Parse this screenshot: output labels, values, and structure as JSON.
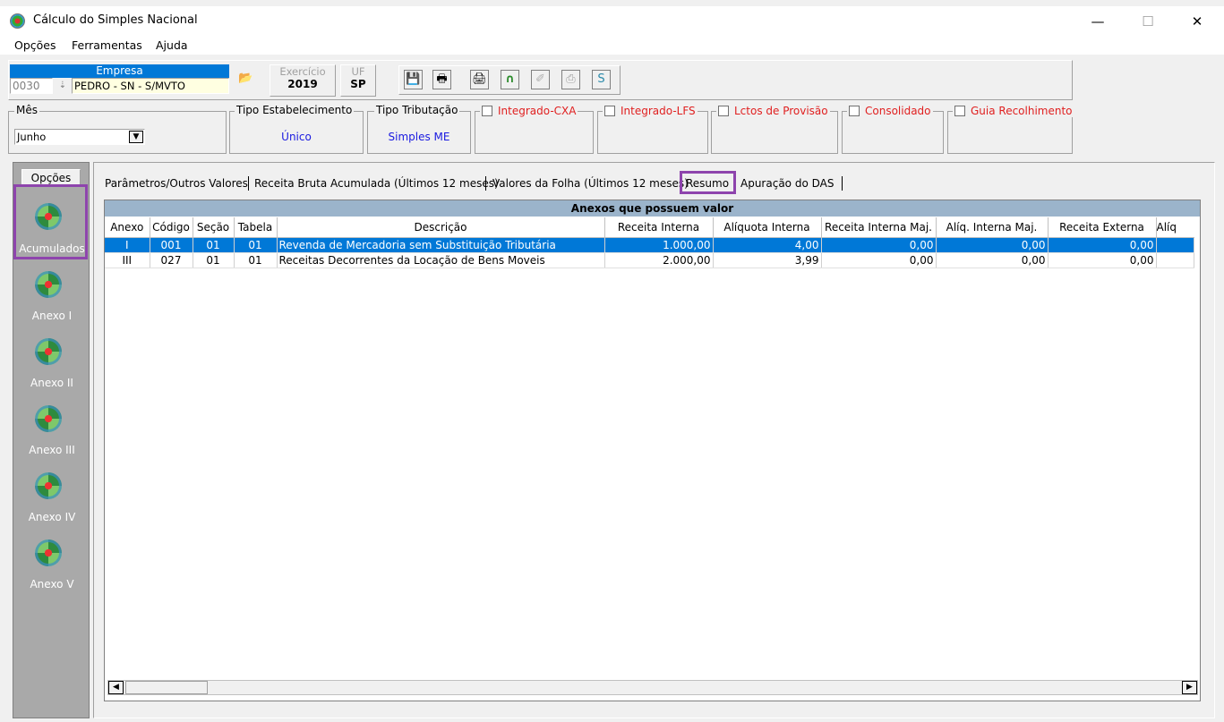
{
  "window": {
    "title": "Cálculo do Simples Nacional",
    "minimize": "—",
    "maximize": "☐",
    "close": "✕"
  },
  "menu": {
    "opcoes": "Opções",
    "ferramentas": "Ferramentas",
    "ajuda": "Ajuda"
  },
  "empresa": {
    "label": "Empresa",
    "code": "0030",
    "name": "PEDRO - SN - S/MVTO"
  },
  "exercicio": {
    "label": "Exercício",
    "value": "2019"
  },
  "uf": {
    "label": "UF",
    "value": "SP"
  },
  "mes": {
    "label": "Mês",
    "value": "Junho"
  },
  "tipo_estabelecimento": {
    "label": "Tipo Estabelecimento",
    "value": "Único"
  },
  "tipo_tributacao": {
    "label": "Tipo Tributação",
    "value": "Simples ME"
  },
  "checkboxes": {
    "integrado_cxa": "Integrado-CXA",
    "integrado_lfs": "Integrado-LFS",
    "lctos_provisao": "Lctos de Provisão",
    "consolidado": "Consolidado",
    "guia_recolhimento": "Guia Recolhimento"
  },
  "sidebar": {
    "header": "Opções",
    "items": [
      "Acumulados",
      "Anexo I",
      "Anexo II",
      "Anexo III",
      "Anexo IV",
      "Anexo V"
    ]
  },
  "tabs": [
    "Parâmetros/Outros Valores",
    "Receita Bruta Acumulada (Últimos 12 meses)",
    "Valores da Folha (Últimos 12 meses)",
    "Resumo",
    "Apuração do DAS"
  ],
  "grid": {
    "caption": "Anexos que possuem valor",
    "columns": [
      "Anexo",
      "Código",
      "Seção",
      "Tabela",
      "Descrição",
      "Receita Interna",
      "Alíquota Interna",
      "Receita Interna Maj.",
      "Alíq. Interna Maj.",
      "Receita Externa",
      "Alíq"
    ],
    "rows": [
      [
        "I",
        "001",
        "01",
        "01",
        "Revenda de Mercadoria sem Substituição Tributária",
        "1.000,00",
        "4,00",
        "0,00",
        "0,00",
        "0,00"
      ],
      [
        "III",
        "027",
        "01",
        "01",
        "Receitas Decorrentes da Locação de Bens Moveis",
        "2.000,00",
        "3,99",
        "0,00",
        "0,00",
        "0,00"
      ]
    ]
  },
  "colors": {
    "selection": "#0078d7",
    "highlight": "#8e44ad",
    "caption_bg": "#9bb4cb",
    "red_label": "#e02020"
  }
}
